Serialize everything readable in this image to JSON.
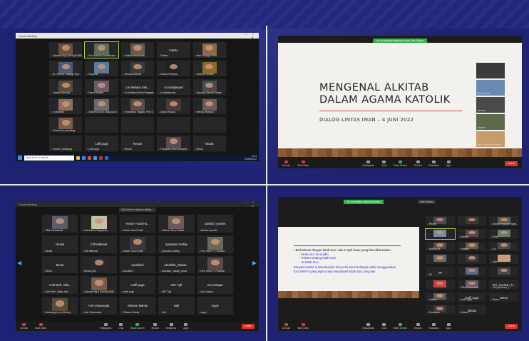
{
  "panel_tl": {
    "title": "Zoom Meeting",
    "tiles": [
      {
        "big": "",
        "name": "Sylvania Ng 5 (Keh)(00085)",
        "v": "#6a4e3e"
      },
      {
        "big": "",
        "name": "Rm Andreas Sansahrauri",
        "v": "#5a6a5a",
        "active": true
      },
      {
        "big": "",
        "name": "Kristina Hendriwati",
        "v": "#6a5a4a"
      },
      {
        "big": "Fidelia",
        "name": "Fidelia",
        "v": ""
      },
      {
        "big": "",
        "name": "Sam Sanjaya Putri",
        "v": "#8a6a4a"
      },
      {
        "big": "",
        "name": "Dr. Helena Frisadgo Ryo",
        "v": "#4a5a7a"
      },
      {
        "big": "",
        "name": "Sayanita",
        "v": "#5a7a9a"
      },
      {
        "big": "",
        "name": "Hendra Julianto",
        "v": "#3a3a3a"
      },
      {
        "big": "",
        "name": "Kirana Theresia",
        "v": "#222"
      },
      {
        "big": "",
        "name": "Yoseph Christon",
        "v": "#8a6a2a"
      },
      {
        "big": "",
        "name": "Yuliana Santosa",
        "v": "#5a4a3a"
      },
      {
        "big": "",
        "name": "Eileen Kartika",
        "v": "#6a5a6a"
      },
      {
        "big": "Lie Meilana Seti...",
        "name": "Lie Meilana Setia Pangastuti",
        "v": ""
      },
      {
        "big": "m.hatiatjaruati",
        "name": "m.hatiatjaruati",
        "v": ""
      },
      {
        "big": "",
        "name": "Sylvania Sandra Yuliani",
        "v": "#4a4a4a"
      },
      {
        "big": "a",
        "name": "a deliyanto",
        "v": "#8b6e5e"
      },
      {
        "big": "",
        "name": "ANDREAS BE AMALIANTO",
        "v": "#6a6a6a"
      },
      {
        "big": "",
        "name": "Fransiskus Tarigan, PhD S.",
        "v": "#5a4a4a"
      },
      {
        "big": "",
        "name": "Adrian Kirana",
        "v": "#4a3a3a"
      },
      {
        "big": "",
        "name": "Wenny Wahyuni",
        "v": "#6a5a5a"
      },
      {
        "big": "",
        "name": "Vincentius_bambang",
        "v": "#7a5a4a"
      },
      {
        "big": "",
        "name": "",
        "v": ""
      },
      {
        "big": "",
        "name": "",
        "v": ""
      },
      {
        "big": "",
        "name": "",
        "v": ""
      },
      {
        "big": "",
        "name": "",
        "v": ""
      },
      {
        "big": "",
        "name": "Vincent_bambang",
        "v": ""
      },
      {
        "big": "Luffi pugs",
        "name": "Luffi pugs",
        "v": ""
      },
      {
        "big": "Renan",
        "name": "Renan",
        "v": ""
      },
      {
        "big": "",
        "name": "Fransiska Heru Siswanto",
        "v": "#5a4a4a"
      },
      {
        "big": "Nicola",
        "name": "Nicola",
        "v": ""
      }
    ],
    "search": "Type here to search",
    "clock_time": "9:41",
    "clock_date": "04/06/2022"
  },
  "panel_tr": {
    "recording_bar": "You are viewing Kanisius's screen  View Options",
    "view_options": "View Options",
    "slide_title_1": "MENGENAL ALKITAB",
    "slide_title_2": "DALAM AGAMA KATOLIK",
    "slide_subtitle": "DIALOG LINTAS IMAN – 4 JUNI 2022",
    "side_tiles": [
      {
        "name": "",
        "v": "#3a3a3a"
      },
      {
        "name": "Rm Andreas",
        "v": "#6a8ab0"
      },
      {
        "name": "Hendra",
        "v": "#4a4a4a"
      },
      {
        "name": "Kristina",
        "v": "#5a6a4a"
      },
      {
        "name": "Rev. Ahmad Hermawan",
        "v": "#c89b6a"
      }
    ]
  },
  "panel_bl": {
    "title": "Zoom Meeting",
    "banner": "Click Here to view as a dialog...",
    "tiles": [
      {
        "big": "",
        "name": "Tiffa Gunawandi",
        "v": "#5a5a6a"
      },
      {
        "big": "",
        "name": "Fransiskus Bayu(AM)",
        "v": "#c8bfa8"
      },
      {
        "big": "Anwar Yusuf Hu...",
        "name": "Anwar Yusuf Husin",
        "v": ""
      },
      {
        "big": "",
        "name": "Valeria Harry Praska",
        "v": "#6a5a5a"
      },
      {
        "big": "adinda f yasmin",
        "name": "adinda f yasmin",
        "v": ""
      },
      {
        "big": "Nindia",
        "name": "Nindia",
        "v": ""
      },
      {
        "big": "Clift Milleniel",
        "name": "Clift Milleniel",
        "v": ""
      },
      {
        "big": "",
        "name": "Anwar Yusuf Husin",
        "v": "#3a3a3a"
      },
      {
        "big": "Syamsiar Saftiky",
        "name": "Syamsiar Saftiky",
        "v": ""
      },
      {
        "big": "",
        "name": "Rev. Henri H. Pardede",
        "v": "#6a6a5a"
      },
      {
        "big": "Benar",
        "name": "Benar",
        "v": ""
      },
      {
        "big": "",
        "name": "Benar (Sa)",
        "v": "#2a2a2a"
      },
      {
        "big": "claudiltch",
        "name": "claudiltch",
        "v": ""
      },
      {
        "big": "Abdullah_zakiah...",
        "name": "Abdullah_zakiah_proud",
        "v": ""
      },
      {
        "big": "",
        "name": "Rev. Henri H. Pardede",
        "v": "#5a4a4a"
      },
      {
        "big": "Andi Muh. Alfia...",
        "name": "Andi Muh. Alfian Ariel",
        "v": ""
      },
      {
        "big": "",
        "name": "Sylvania Ng 5 (Keh)(00085)",
        "v": "#7a5a4a"
      },
      {
        "big": "muffi pugs",
        "name": "muffi pugs",
        "v": ""
      },
      {
        "big": "ABT Tgfr",
        "name": "ABT Tgfr",
        "v": ""
      },
      {
        "big": "Ima Gaspar",
        "name": "Ima Gaspar",
        "v": ""
      },
      {
        "big": "",
        "name": "Bambang Liem (Guide)",
        "v": "#5a4a3a"
      },
      {
        "big": "Anh Chanorada",
        "name": "Anh Chanorada",
        "v": ""
      },
      {
        "big": "Shireen Mahila",
        "name": "Shireen Mahila",
        "v": ""
      },
      {
        "big": "Dell",
        "name": "Dell",
        "v": ""
      },
      {
        "big": "nuyyr",
        "name": "nuyyr",
        "v": ""
      }
    ]
  },
  "panel_br": {
    "recording_bar": "You are viewing Kanisius's screen",
    "view_options": "View Options",
    "slide_heading": "• Berbantuan dengan Kitab Suci, ada 3 topik besar yang bisa dibicarakan:",
    "bullets": [
      "- Kitab Suci itu sendiri",
      "- Paham tentang Kitab Suci",
      "- Isi Kitab Suci"
    ],
    "body": "Banyak mesteri & kekeliruanan dari perlu terus berlanjut untuk menggunakan KACAMATA yang tepat untuk memahami Kitab Suci yang lain.",
    "tiles": [
      {
        "big": "",
        "name": "Renan",
        "v": "#4a4a5a"
      },
      {
        "big": "",
        "name": "",
        "v": "#3a3a3a"
      },
      {
        "big": "",
        "name": "Ahmad Yassyan Syah...",
        "v": "#5a5a4a"
      },
      {
        "big": "",
        "name": "",
        "v": "#7a8aa0",
        "active": true
      },
      {
        "big": "",
        "name": "Ahmad",
        "v": "#5a4a4a"
      },
      {
        "big": "",
        "name": "Eddy",
        "v": "#6a7a6a"
      },
      {
        "big": "",
        "name": "ANHUKOL",
        "v": "#5a4a4a"
      },
      {
        "big": "",
        "name": "Setyani",
        "v": "#6a5a4a"
      },
      {
        "big": "",
        "name": "SA",
        "v": "#4a4a4a"
      },
      {
        "big": "",
        "name": "",
        "v": "#6a6a6a"
      },
      {
        "big": "",
        "name": "",
        "v": "#3a3a3a"
      },
      {
        "big": "",
        "name": "Adhi",
        "v": "#c8a07a"
      },
      {
        "big": "AP",
        "name": "AP",
        "v": ""
      },
      {
        "big": "",
        "name": "",
        "v": "#5a6a7a"
      },
      {
        "big": "",
        "name": "",
        "v": "#4a4a4a"
      },
      {
        "big": "",
        "name": "",
        "v": "#d04040"
      },
      {
        "big": "",
        "name": "Tiffa Gunawandi",
        "v": "#6a5a6a"
      },
      {
        "big": "Vivi_seruhan_h...",
        "name": "Vivi_seruhan_h",
        "v": ""
      },
      {
        "big": "",
        "name": "Valeria",
        "v": "#5a5a5a"
      },
      {
        "big": "muffi pugs",
        "name": "muffi pugs",
        "v": ""
      },
      {
        "big": "Benar",
        "name": "Benar",
        "v": ""
      },
      {
        "big": "",
        "name": "Fransiska",
        "v": "#3a3a3a"
      },
      {
        "big": "Nindia",
        "name": "Nindia",
        "v": ""
      }
    ]
  },
  "toolbar": {
    "unmute": "Unmute",
    "video": "Start Video",
    "participants": "Participants",
    "chat": "Chat",
    "share": "Share Screen",
    "record": "Record",
    "reactions": "Reactions",
    "apps": "Apps",
    "end": "Leave"
  }
}
